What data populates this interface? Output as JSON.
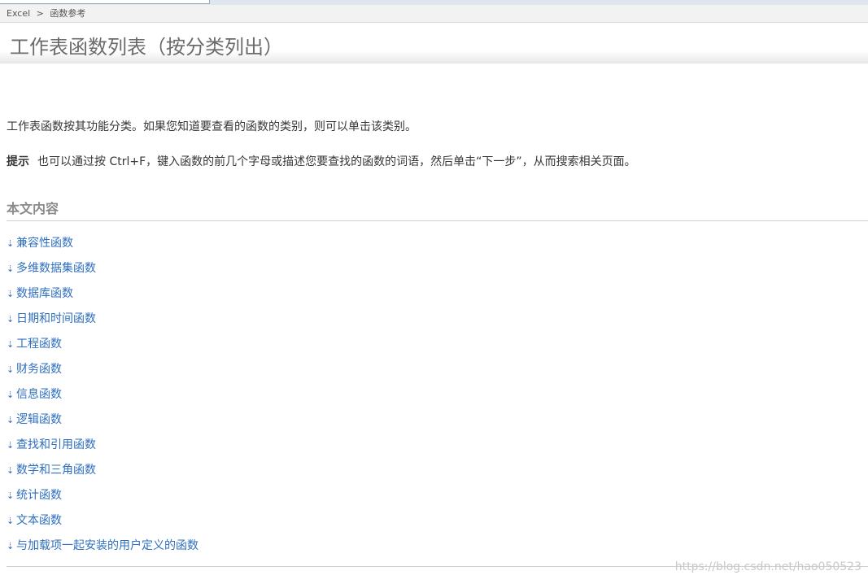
{
  "breadcrumb": {
    "root": "Excel",
    "separator": ">",
    "current": "函数参考"
  },
  "page_title": "工作表函数列表（按分类列出）",
  "intro_text": "工作表函数按其功能分类。如果您知道要查看的函数的类别，则可以单击该类别。",
  "tip": {
    "label": "提示",
    "text": "也可以通过按 Ctrl+F，键入函数的前几个字母或描述您要查找的函数的词语，然后单击“下一步”，从而搜索相关页面。"
  },
  "section_heading": "本文内容",
  "toc_arrow_icon": "arrow-down-icon",
  "toc_items": [
    "兼容性函数",
    "多维数据集函数",
    "数据库函数",
    "日期和时间函数",
    "工程函数",
    "财务函数",
    "信息函数",
    "逻辑函数",
    "查找和引用函数",
    "数学和三角函数",
    "统计函数",
    "文本函数",
    "与加载项一起安装的用户定义的函数"
  ],
  "watermark": "https://blog.csdn.net/hao050523",
  "colors": {
    "link": "#2f6fbf",
    "title": "#6b6b6b",
    "heading": "#8a8a8a"
  }
}
